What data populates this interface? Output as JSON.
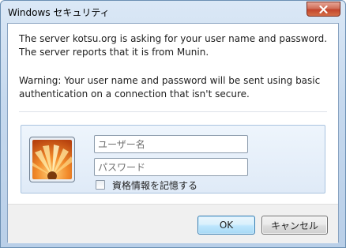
{
  "window": {
    "title": "Windows セキュリティ",
    "close_icon": "close-icon"
  },
  "message": {
    "line1": "The server kotsu.org is asking for your user name and password.",
    "line2": "The server reports that it is from Munin.",
    "warning_line1": "Warning: Your user name and password will be sent using basic",
    "warning_line2": "authentication on a connection that isn't secure."
  },
  "credentials": {
    "user_tile_icon": "user-tile-flower-icon",
    "username_placeholder": "ユーザー名",
    "username_value": "",
    "password_placeholder": "パスワード",
    "password_value": "",
    "remember_label": "資格情報を記憶する",
    "remember_checked": false
  },
  "buttons": {
    "ok_label": "OK",
    "cancel_label": "キャンセル"
  },
  "colors": {
    "accent": "#3c7fb1",
    "panel": "#e6eff9",
    "close": "#c3452b"
  }
}
